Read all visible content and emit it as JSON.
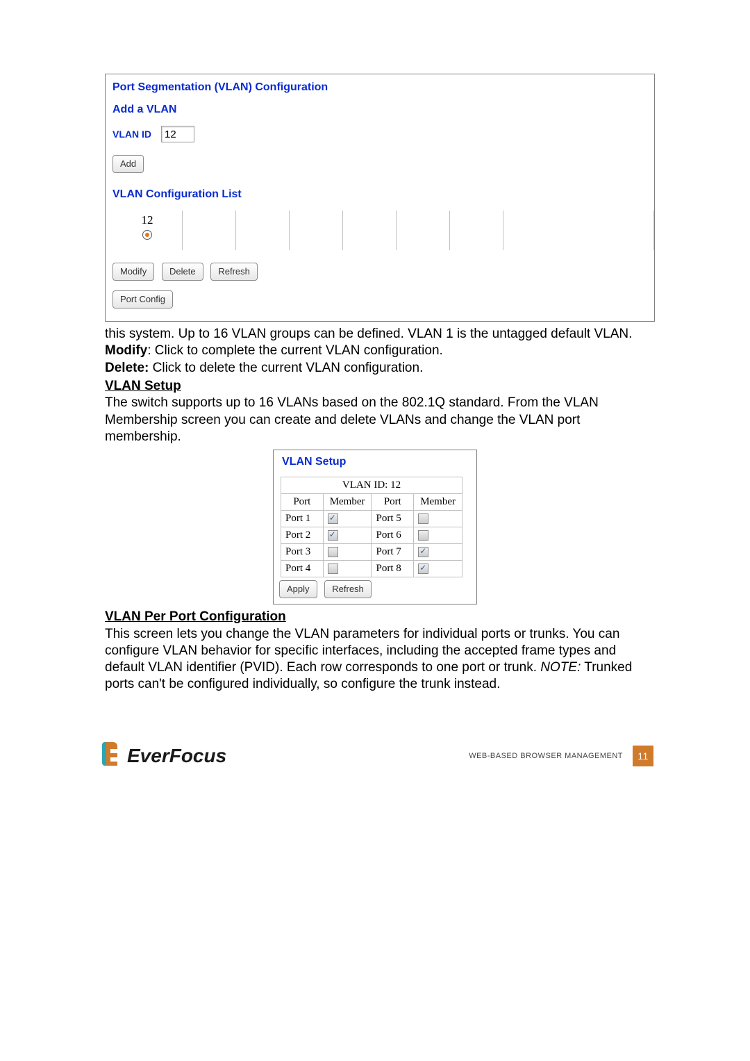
{
  "shot1": {
    "title": "Port Segmentation (VLAN) Configuration",
    "add_section": "Add a VLAN",
    "vlan_id_label": "VLAN ID",
    "vlan_id_value": "12",
    "add_btn": "Add",
    "list_section": "VLAN Configuration List",
    "list_value": "12",
    "modify_btn": "Modify",
    "delete_btn": "Delete",
    "refresh_btn": "Refresh",
    "port_config_btn": "Port Config"
  },
  "para1_a": "this system. Up to 16 VLAN groups can be defined. VLAN 1 is the untagged default VLAN.",
  "modify_label": "Modify",
  "modify_text": ": Click to complete the current VLAN configuration.",
  "delete_label": "Delete:",
  "delete_text": " Click to delete the current VLAN configuration.",
  "vlan_setup_hdr": "VLAN Setup",
  "vlan_setup_para": "The switch supports up to 16 VLANs based on the 802.1Q standard. From the VLAN Membership screen you can create and delete VLANs and change the VLAN port membership.",
  "shot2": {
    "title": "VLAN Setup",
    "vlan_id_row": "VLAN ID: 12",
    "hdr_port": "Port",
    "hdr_member": "Member",
    "rows": [
      {
        "p1": "Port 1",
        "m1": true,
        "p2": "Port 5",
        "m2": false
      },
      {
        "p1": "Port 2",
        "m1": true,
        "p2": "Port 6",
        "m2": false
      },
      {
        "p1": "Port 3",
        "m1": false,
        "p2": "Port 7",
        "m2": true
      },
      {
        "p1": "Port 4",
        "m1": false,
        "p2": "Port 8",
        "m2": true
      }
    ],
    "apply_btn": "Apply",
    "refresh_btn": "Refresh"
  },
  "perport_hdr": "VLAN Per Port Configuration",
  "perport_para": "This screen lets you change the VLAN parameters for individual ports or trunks. You can configure VLAN behavior for specific interfaces, including the accepted frame types and default VLAN identifier (PVID). Each row  corresponds to one port or trunk. ",
  "perport_note_label": "NOTE:",
  "perport_note": " Trunked ports can't be configured individually, so configure the trunk instead.",
  "footer": {
    "brand": "EverFocus",
    "label": "WEB-BASED BROWSER MANAGEMENT",
    "page": "11"
  }
}
